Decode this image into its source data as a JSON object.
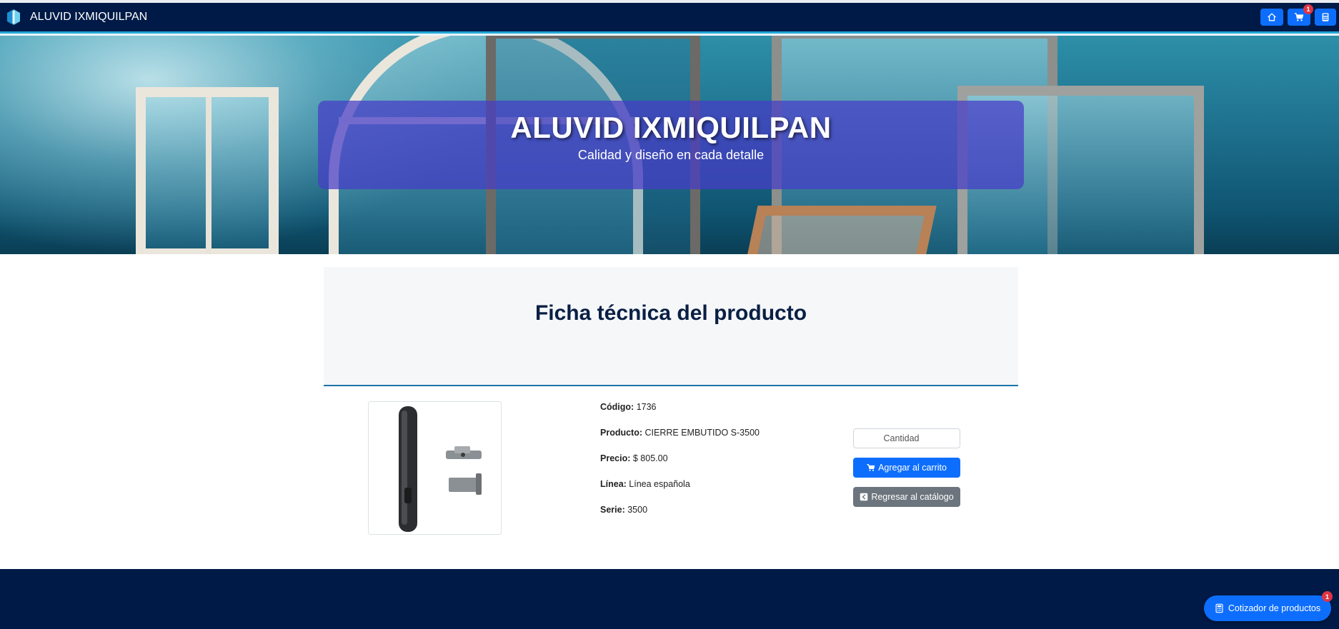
{
  "navbar": {
    "brand": "ALUVID IXMIQUILPAN",
    "cart_badge": "1",
    "icons": [
      "home-icon",
      "cart-icon",
      "calculator-icon"
    ]
  },
  "hero": {
    "title": "ALUVID IXMIQUILPAN",
    "subtitle": "Calidad y diseño en cada detalle"
  },
  "ficha": {
    "title": "Ficha técnica del producto"
  },
  "product": {
    "codigo_label": "Código:",
    "codigo": "1736",
    "producto_label": "Producto:",
    "producto": "CIERRE EMBUTIDO S-3500",
    "precio_label": "Precio:",
    "precio": "$ 805.00",
    "linea_label": "Línea:",
    "linea": "Línea española",
    "serie_label": "Serie:",
    "serie": "3500"
  },
  "actions": {
    "quantity_placeholder": "Cantidad",
    "add_to_cart": "Agregar al carrito",
    "back_to_catalog": "Regresar al catálogo"
  },
  "floating": {
    "cotizador_label": "Cotizador de productos",
    "cotizador_badge": "1"
  },
  "colors": {
    "navy": "#001a47",
    "primary": "#0d6efd",
    "secondary": "#6c757d",
    "badge": "#dc3545"
  }
}
